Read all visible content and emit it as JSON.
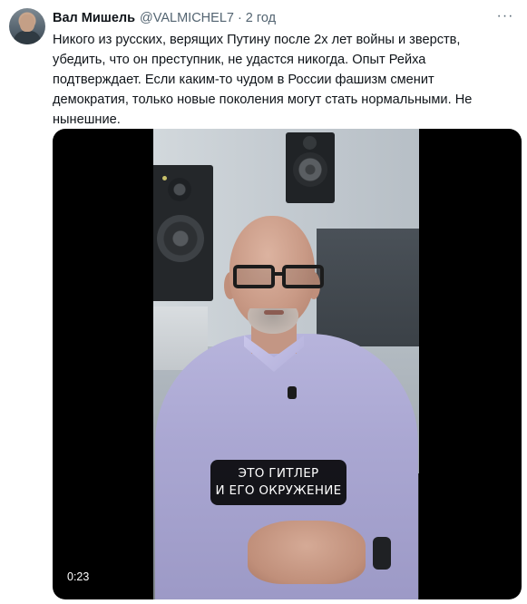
{
  "tweet": {
    "author_name": "Вал Мишель",
    "author_handle": "@VALMICHEL7",
    "separator": "·",
    "timestamp": "2 год",
    "more_icon": "more-horizontal-icon",
    "more_glyph": "···",
    "text_lines": [
      "Никого из русских, верящих Путину после 2х лет войны и зверств,",
      "убедить, что он преступник, не удастся никогда. Опыт Рейха",
      "подтверждает. Если каким-то чудом в России фашизм сменит",
      "демократия, только новые поколения могут стать нормальными. Не",
      "нынешние."
    ]
  },
  "video": {
    "subtitle_lines": [
      "ЭТО ГИТЛЕР",
      "И ЕГО ОКРУЖЕНИЕ"
    ],
    "duration": "0:23"
  },
  "colors": {
    "text_primary": "#0f1419",
    "text_secondary": "#536471",
    "video_background": "#000000"
  }
}
